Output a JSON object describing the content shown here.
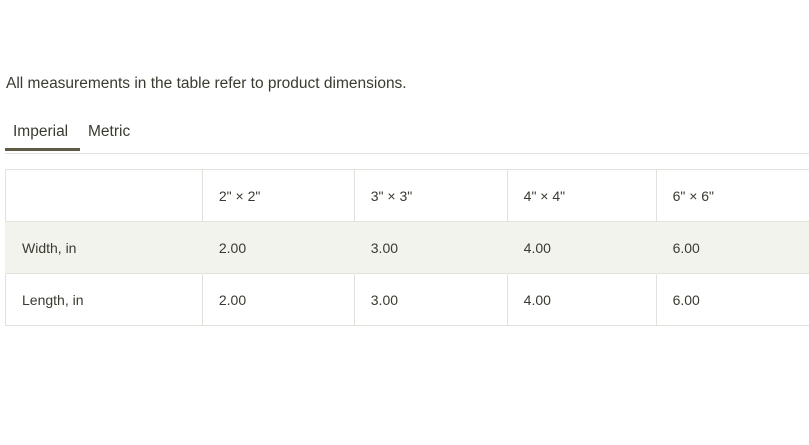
{
  "note": "All measurements in the table refer to product dimensions.",
  "tabs": {
    "imperial": "Imperial",
    "metric": "Metric",
    "active": "Imperial"
  },
  "table": {
    "headers": [
      "",
      "2\" × 2\"",
      "3\" × 3\"",
      "4\" × 4\"",
      "6\" × 6\""
    ],
    "rows": [
      {
        "label": "Width, in",
        "values": [
          "2.00",
          "3.00",
          "4.00",
          "6.00"
        ]
      },
      {
        "label": "Length, in",
        "values": [
          "2.00",
          "3.00",
          "4.00",
          "6.00"
        ]
      }
    ]
  },
  "colors": {
    "text": "#3a3a30",
    "active_tab_underline": "#5f5a46",
    "row_shade": "#f3f3ee",
    "border": "#e2e2dc"
  }
}
